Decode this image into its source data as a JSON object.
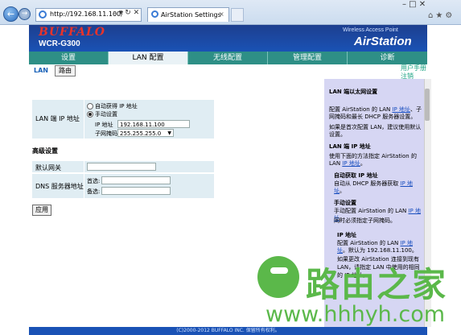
{
  "browser": {
    "url": "http://192.168.11.100/",
    "tab_title": "AirStation Settings",
    "tab_close": "×",
    "addr_actions": "⌕ ▾ ↻ ✕",
    "window_controls": "–  □  ✕",
    "right_icons": "⌂★⚙"
  },
  "header": {
    "logo": "BUFFALO",
    "model": "WCR-G300",
    "subtitle": "Wireless Access Point",
    "brand": "AirStation"
  },
  "nav": {
    "tabs": [
      {
        "label": "设置"
      },
      {
        "label": "LAN 配置"
      },
      {
        "label": "无线配置"
      },
      {
        "label": "管理配置"
      },
      {
        "label": "诊断"
      }
    ],
    "active_index": 1
  },
  "subnav": {
    "lan": "LAN",
    "route": "路由",
    "manual_1": "用户手册",
    "manual_2": "注销"
  },
  "form": {
    "lan_ip_label": "LAN 端 IP 地址",
    "auto_ip": "自动获得 IP 地址",
    "manual": "手动设置",
    "ip_label": "IP 地址",
    "ip_value": "192.168.11.100",
    "mask_label": "子网掩码",
    "mask_value": "255.255.255.0",
    "advanced": "高级设置",
    "gateway_label": "默认网关",
    "dns_label": "DNS 服务器地址",
    "primary": "首选:",
    "secondary": "备选:",
    "apply": "应用"
  },
  "help": {
    "title": "LAN 端以太网设置",
    "p1a": "配置 AirStation 的 LAN ",
    "p1link": "IP 地址",
    "p1b": "、子网掩码和最长 DHCP 服务器设置。",
    "p1c": "如果是首次配置 LAN，建议使用默认设置。",
    "s2": "LAN 端 IP 地址",
    "p2a": "使用下面的方法指定 AirStation 的 LAN ",
    "p2link": "IP 地址",
    "p2b": "。",
    "s3": "自动获取 IP 地址",
    "p3a": "自动从 DHCP 服务器获取 ",
    "p3link": "IP 地址",
    "p3b": "。",
    "s4": "手动设置",
    "p4a": "手动配置 AirStation 的 LAN ",
    "p4link": "IP 地址",
    "p4b": "。",
    "p4c": "同时必须指定子网掩码。",
    "s5": "IP 地址",
    "p5a": "配置 AirStation 的 LAN ",
    "p5link": "IP 地址",
    "p5b": "。默认为 192.168.11.100。",
    "p5c": "如果更改 AirStation 连接到现有",
    "p5d": "LAN，请指定 LAN 中使用的相同",
    "p5e": "的 IP 地址。"
  },
  "footer": "(C)2000-2012 BUFFALO INC. 保留所有权利。",
  "watermark": {
    "text": "路由之家",
    "url": "www.hhhyh.com"
  },
  "colors": {
    "header_blue": "#1d3f8f",
    "nav_teal": "#2e8f86",
    "help_lavender": "#d6d6f3",
    "form_bg": "#e0edf3",
    "watermark_green": "#5bb84a"
  }
}
